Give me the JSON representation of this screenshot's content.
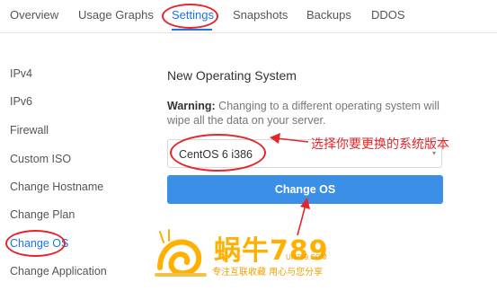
{
  "tabs": [
    {
      "label": "Overview"
    },
    {
      "label": "Usage Graphs"
    },
    {
      "label": "Settings",
      "active": true
    },
    {
      "label": "Snapshots"
    },
    {
      "label": "Backups"
    },
    {
      "label": "DDOS"
    }
  ],
  "sidebar": {
    "items": [
      {
        "label": "IPv4"
      },
      {
        "label": "IPv6"
      },
      {
        "label": "Firewall"
      },
      {
        "label": "Custom ISO"
      },
      {
        "label": "Change Hostname"
      },
      {
        "label": "Change Plan"
      },
      {
        "label": "Change OS",
        "active": true
      },
      {
        "label": "Change Application"
      }
    ]
  },
  "main": {
    "title": "New Operating System",
    "warning_label": "Warning:",
    "warning_text": " Changing to a different operating system will wipe all the data on your server.",
    "os_select_value": "CentOS 6 i386",
    "change_os_button": "Change OS"
  },
  "annotation": {
    "text": "选择你要更换的系统版本",
    "color": "#e4262a"
  },
  "watermark": {
    "main": "蜗牛789",
    "url": "UN789.COM",
    "sub": "专注互联收藏 用心与您分享"
  },
  "colors": {
    "accent": "#1a73e8",
    "button": "#3b8fe6",
    "annotation": "#e4262a",
    "watermark": "#ffb000"
  }
}
